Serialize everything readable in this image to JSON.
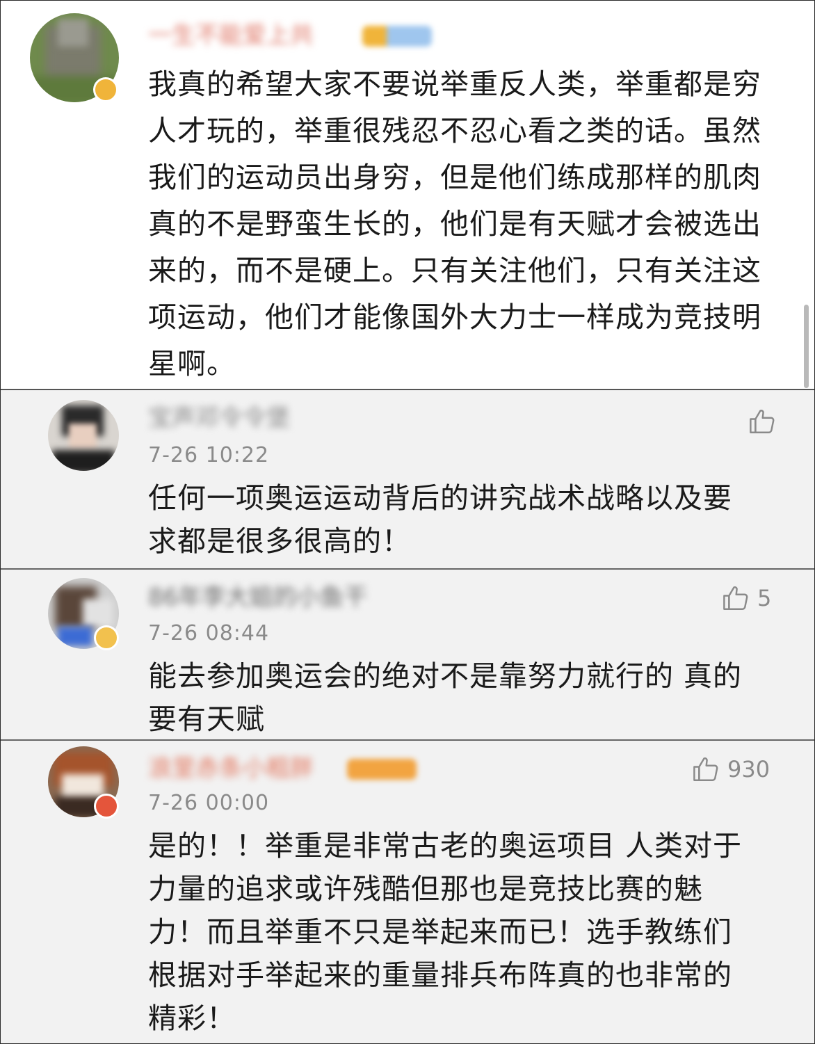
{
  "comments": [
    {
      "username": "一生不能爱上共",
      "time": "",
      "text": "我真的希望大家不要说举重反人类，举重都是穷人才玩的，举重很残忍不忍心看之类的话。虽然我们的运动员出身穷，但是他们练成那样的肌肉真的不是野蛮生长的，他们是有天赋才会被选出来的，而不是硬上。只有关注他们，只有关注这项运动，他们才能像国外大力士一样成为竞技明星啊。",
      "likes": ""
    },
    {
      "username": "宝声邓令令堡",
      "time": "7-26 10:22",
      "text": "任何一项奥运运动背后的讲究战术战略以及要求都是很多很高的！",
      "likes": ""
    },
    {
      "username": "86年李大姐的小鱼干",
      "time": "7-26 08:44",
      "text": "能去参加奥运会的绝对不是靠努力就行的 真的要有天赋",
      "likes": "5"
    },
    {
      "username": "浪里赤条小粗胖",
      "time": "7-26 00:00",
      "text": "是的！！举重是非常古老的奥运项目 人类对于力量的追求或许残酷但那也是竞技比赛的魅力！而且举重不只是举起来而已！选手教练们根据对手举起来的重量排兵布阵真的也非常的精彩！",
      "likes": "930"
    }
  ],
  "colors": {
    "text": "#1a1a1a",
    "meta": "#8a8a8a",
    "highlight_bg": "#ffffff",
    "row_bg": "#f2f2f2",
    "vip_badge": "#f0b43a"
  },
  "icons": {
    "like": "thumbs-up-icon"
  }
}
